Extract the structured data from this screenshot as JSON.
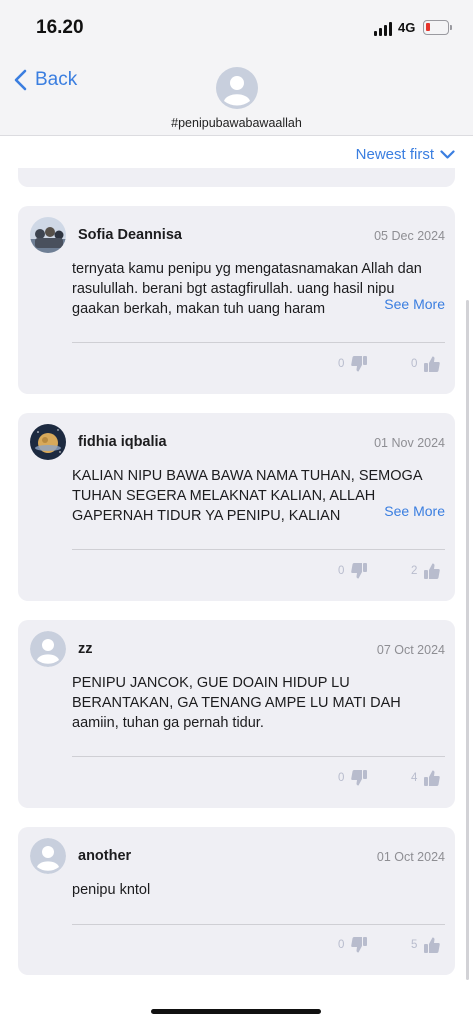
{
  "status_bar": {
    "time": "16.20",
    "network": "4G",
    "battery_percent": 10
  },
  "nav": {
    "back_label": "Back",
    "title": "#penipubawabawaallah"
  },
  "sort": {
    "label": "Newest first"
  },
  "colors": {
    "accent": "#3a7ee0",
    "card_bg": "#efeff4",
    "icon_muted": "#b8bccd",
    "battery_low": "#e5342c"
  },
  "comments": [
    {
      "author": "Sofia Deannisa",
      "date": "05 Dec 2024",
      "text": "ternyata kamu penipu yg mengatasnamakan Allah dan rasulullah. berani bgt astagfirullah. uang hasil nipu gaakan berkah, makan tuh uang haram",
      "see_more": "See More",
      "dislikes": "0",
      "likes": "0"
    },
    {
      "author": "fidhia iqbalia",
      "date": "01 Nov 2024",
      "text": "KALIAN NIPU BAWA BAWA NAMA TUHAN, SEMOGA TUHAN SEGERA MELAKNAT KALIAN, ALLAH GAPERNAH TIDUR YA PENIPU, KALIAN",
      "see_more": "See More",
      "dislikes": "0",
      "likes": "2"
    },
    {
      "author": "zz",
      "date": "07 Oct 2024",
      "text": "PENIPU JANCOK, GUE DOAIN HIDUP LU BERANTAKAN, GA TENANG AMPE LU MATI DAH aamiin, tuhan ga pernah tidur.",
      "dislikes": "0",
      "likes": "4"
    },
    {
      "author": "another",
      "date": "01 Oct 2024",
      "text": "penipu kntol",
      "dislikes": "0",
      "likes": "5"
    }
  ]
}
